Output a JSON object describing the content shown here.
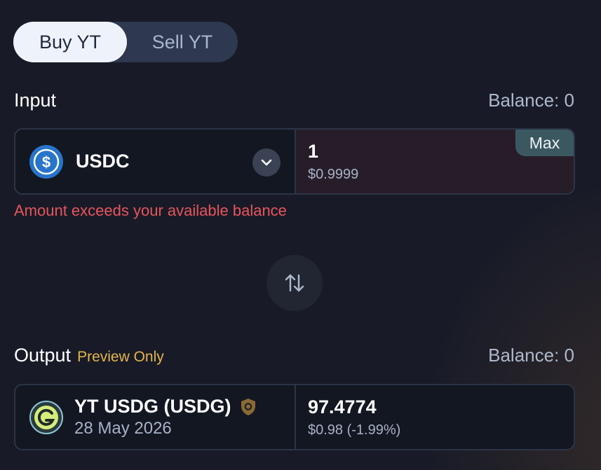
{
  "toggle": {
    "buy_label": "Buy YT",
    "sell_label": "Sell YT"
  },
  "input": {
    "label": "Input",
    "balance": "Balance: 0",
    "token": {
      "name": "USDC",
      "icon": "usdc-icon"
    },
    "amount": "1",
    "usd_value": "$0.9999",
    "max_label": "Max",
    "error": "Amount exceeds your available balance"
  },
  "swap": {
    "icon": "swap-arrows-icon"
  },
  "output": {
    "label": "Output",
    "preview_tag": "Preview Only",
    "balance": "Balance: 0",
    "token": {
      "name": "YT USDG (USDG)",
      "date": "28 May 2026",
      "icon": "usdg-icon",
      "badge_icon": "shield-icon"
    },
    "amount": "97.4774",
    "usd_value": "$0.98 (-1.99%)"
  },
  "colors": {
    "background": "#181b27",
    "error": "#e8545c",
    "preview": "#e6b54a",
    "usdc_blue": "#2775ca",
    "max_bg": "#3b5860"
  }
}
